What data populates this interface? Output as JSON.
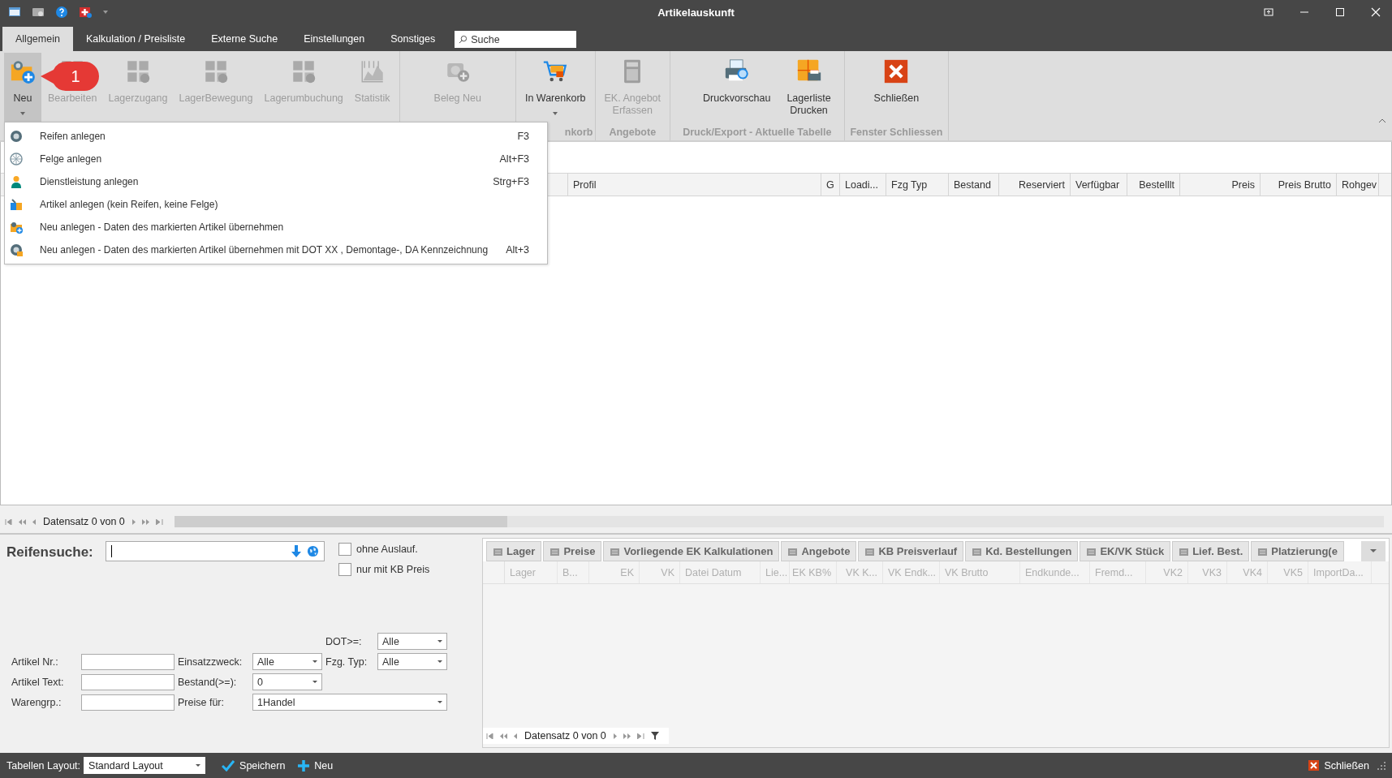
{
  "window": {
    "title": "Artikelauskunft"
  },
  "tabs": [
    {
      "label": "Allgemein",
      "selected": true
    },
    {
      "label": "Kalkulation / Preisliste",
      "selected": false
    },
    {
      "label": "Externe Suche",
      "selected": false
    },
    {
      "label": "Einstellungen",
      "selected": false
    },
    {
      "label": "Sonstiges",
      "selected": false
    }
  ],
  "search": {
    "placeholder": "Suche"
  },
  "ribbon": {
    "groups": [
      {
        "buttons": [
          {
            "label": "Neu",
            "kind": "new",
            "disabled": false,
            "pressed": true,
            "dropdown": true
          },
          {
            "label": "Bearbeiten",
            "kind": "grid-edit",
            "disabled": true,
            "pressed": false,
            "dropdown": false
          },
          {
            "label": "Lagerzugang",
            "kind": "grid-plus",
            "disabled": true,
            "pressed": false,
            "dropdown": false
          },
          {
            "label": "LagerBewegung",
            "kind": "grid-alert",
            "disabled": true,
            "pressed": false,
            "dropdown": false
          },
          {
            "label": "Lagerumbuchung",
            "kind": "grid-refresh",
            "disabled": true,
            "pressed": false,
            "dropdown": false
          },
          {
            "label": "Statistik",
            "kind": "stats",
            "disabled": true,
            "pressed": false,
            "dropdown": false
          }
        ]
      },
      {
        "buttons": [
          {
            "label": "Beleg Neu",
            "kind": "receipt",
            "disabled": true,
            "pressed": false,
            "dropdown": false
          }
        ]
      },
      {
        "label": "nkorb",
        "partial": true,
        "buttons": [
          {
            "label": "In Warenkorb",
            "kind": "cart",
            "disabled": false,
            "pressed": false,
            "dropdown": true
          }
        ]
      },
      {
        "label": "Angebote",
        "partial": false,
        "buttons": [
          {
            "label": "EK. Angebot\nErfassen",
            "kind": "calculator",
            "disabled": true,
            "pressed": false,
            "dropdown": false
          }
        ]
      },
      {
        "label": "Druck/Export - Aktuelle Tabelle",
        "partial": false,
        "buttons": [
          {
            "label": "Druckvorschau",
            "kind": "preview",
            "disabled": false,
            "pressed": false,
            "dropdown": false
          },
          {
            "label": "Lagerliste\nDrucken",
            "kind": "print",
            "disabled": false,
            "pressed": false,
            "dropdown": false
          }
        ]
      },
      {
        "label": "Fenster Schliessen",
        "partial": false,
        "buttons": [
          {
            "label": "Schließen",
            "kind": "close",
            "disabled": false,
            "pressed": false,
            "dropdown": false
          }
        ]
      }
    ]
  },
  "callout": {
    "text": "1"
  },
  "menu": {
    "items": [
      {
        "kind": "tire",
        "label": "Reifen anlegen",
        "shortcut": "F3"
      },
      {
        "kind": "rim",
        "label": "Felge anlegen",
        "shortcut": "Alt+F3"
      },
      {
        "kind": "service",
        "label": "Dienstleistung anlegen",
        "shortcut": "Strg+F3"
      },
      {
        "kind": "article",
        "label": "Artikel anlegen (kein Reifen, keine Felge)"
      },
      {
        "kind": "copy",
        "label": "Neu anlegen - Daten des markierten Artikel übernehmen"
      },
      {
        "kind": "copy-dot",
        "label": "Neu anlegen - Daten des markierten Artikel übernehmen mit DOT XX , Demontage-, DA Kennzeichnung",
        "shortcut": "Alt+3"
      }
    ]
  },
  "grid": {
    "columns": [
      {
        "label": "Profil",
        "numeric": false
      },
      {
        "label": "G",
        "numeric": false
      },
      {
        "label": "Loadi...",
        "numeric": false
      },
      {
        "label": "Fzg Typ",
        "numeric": false
      },
      {
        "label": "Bestand",
        "numeric": false
      },
      {
        "label": "Reserviert",
        "numeric": true
      },
      {
        "label": "Verfügbar",
        "numeric": false
      },
      {
        "label": "Bestelllt",
        "numeric": true
      },
      {
        "label": "Preis",
        "numeric": true
      },
      {
        "label": "Preis Brutto",
        "numeric": true
      },
      {
        "label": "Rohgev",
        "numeric": false
      }
    ],
    "navigator": {
      "text": "Datensatz 0 von 0"
    }
  },
  "search_panel": {
    "title": "Reifensuche:",
    "options": [
      {
        "label": "ohne Auslauf.",
        "checked": false
      },
      {
        "label": "nur mit KB Preis",
        "checked": false
      }
    ],
    "form": {
      "dot": {
        "label": "DOT>=:",
        "value": "Alle"
      },
      "artikel_nr": {
        "label": "Artikel Nr.:"
      },
      "einsatzzweck": {
        "label": "Einsatzzweck:",
        "value": "Alle"
      },
      "fzg_typ": {
        "label": "Fzg. Typ:",
        "value": "Alle"
      },
      "artikel_text": {
        "label": "Artikel Text:"
      },
      "bestand": {
        "label": "Bestand(>=):",
        "value": "0"
      },
      "warengrp": {
        "label": "Warengrp.:"
      },
      "preise_fuer": {
        "label": "Preise für:",
        "value": "1Handel"
      }
    }
  },
  "detail": {
    "tabs": [
      {
        "label": "Lager"
      },
      {
        "label": "Preise"
      },
      {
        "label": "Vorliegende EK Kalkulationen"
      },
      {
        "label": "Angebote"
      },
      {
        "label": "KB Preisverlauf"
      },
      {
        "label": "Kd. Bestellungen"
      },
      {
        "label": "EK/VK Stück"
      },
      {
        "label": "Lief. Best."
      },
      {
        "label": "Platzierung(e"
      }
    ],
    "columns": [
      {
        "label": "Lager",
        "numeric": false
      },
      {
        "label": "B...",
        "numeric": false
      },
      {
        "label": "EK",
        "numeric": true
      },
      {
        "label": "VK",
        "numeric": true
      },
      {
        "label": "Datei Datum",
        "numeric": false
      },
      {
        "label": "Lie...",
        "numeric": false
      },
      {
        "label": "EK KB%",
        "numeric": true
      },
      {
        "label": "VK K...",
        "numeric": true
      },
      {
        "label": "VK Endk...",
        "numeric": false
      },
      {
        "label": "VK Brutto",
        "numeric": false
      },
      {
        "label": "Endkunde...",
        "numeric": false
      },
      {
        "label": "Fremd...",
        "numeric": false
      },
      {
        "label": "VK2",
        "numeric": true
      },
      {
        "label": "VK3",
        "numeric": true
      },
      {
        "label": "VK4",
        "numeric": true
      },
      {
        "label": "VK5",
        "numeric": true
      },
      {
        "label": "ImportDa...",
        "numeric": false
      }
    ],
    "navigator": {
      "text": "Datensatz 0 von 0"
    }
  },
  "status_bar": {
    "layout_label": "Tabellen Layout:",
    "layout_value": "Standard Layout",
    "save": "Speichern",
    "new": "Neu",
    "close": "Schließen"
  }
}
